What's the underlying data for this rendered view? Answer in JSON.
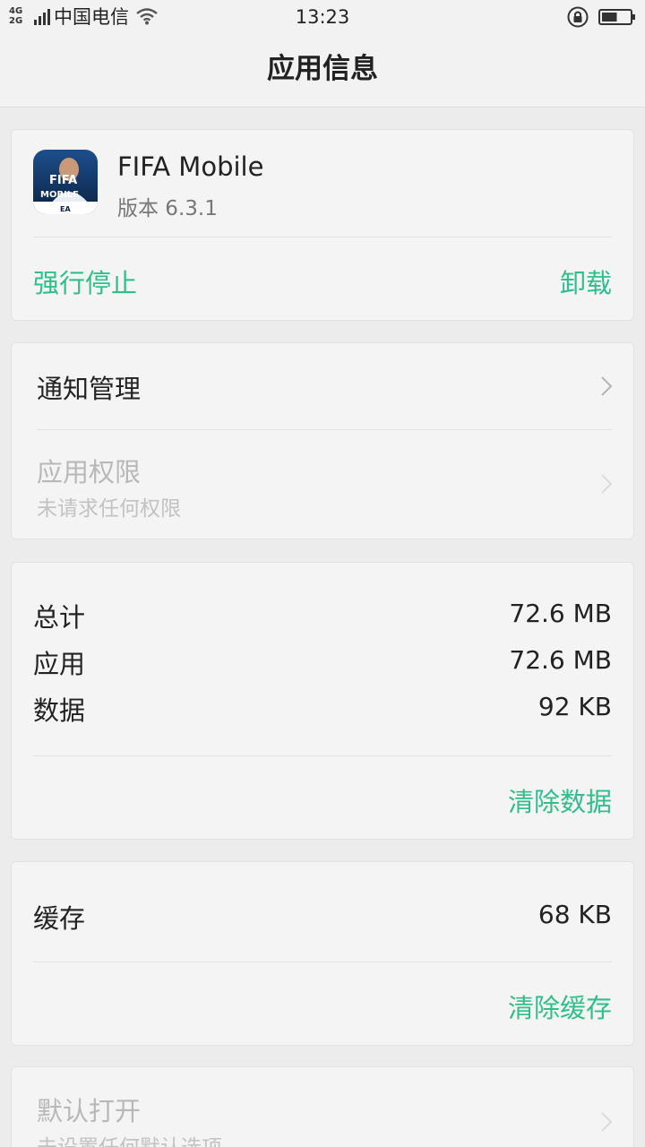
{
  "status_bar": {
    "network_top": "4G",
    "network_bottom": "2G",
    "carrier": "中国电信",
    "time": "13:23",
    "battery_level": 0.55
  },
  "header": {
    "title": "应用信息"
  },
  "app": {
    "name": "FIFA Mobile",
    "version": "版本 6.3.1",
    "icon_lines": [
      "FIFA",
      "MOBILE",
      "EA"
    ],
    "force_stop_label": "强行停止",
    "uninstall_label": "卸载"
  },
  "settings": {
    "notification_label": "通知管理",
    "permissions_label": "应用权限",
    "permissions_sub": "未请求任何权限"
  },
  "storage": {
    "total_label": "总计",
    "total_value": "72.6 MB",
    "app_label": "应用",
    "app_value": "72.6 MB",
    "data_label": "数据",
    "data_value": "92 KB",
    "clear_data_label": "清除数据"
  },
  "cache": {
    "label": "缓存",
    "value": "68 KB",
    "clear_cache_label": "清除缓存"
  },
  "defaults": {
    "label": "默认打开",
    "sub": "未设置任何默认选项"
  },
  "colors": {
    "accent": "#2fbf8c",
    "background": "#ececec",
    "card": "#f4f4f4"
  }
}
